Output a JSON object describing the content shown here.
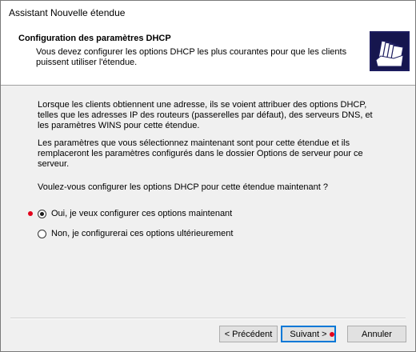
{
  "window": {
    "title": "Assistant Nouvelle étendue"
  },
  "header": {
    "title": "Configuration des paramètres DHCP",
    "subtitle": "Vous devez configurer les options DHCP les plus courantes pour que les clients puissent utiliser l'étendue.",
    "icon": "folder-documents-icon"
  },
  "body": {
    "paragraph1": "Lorsque les clients obtiennent une adresse, ils se voient attribuer des options DHCP, telles que les adresses IP des routeurs (passerelles par défaut), des serveurs DNS, et les paramètres WINS pour cette étendue.",
    "paragraph2": "Les paramètres que vous sélectionnez maintenant sont pour cette étendue et ils remplaceront les paramètres configurés dans le dossier Options de serveur pour ce serveur.",
    "question": "Voulez-vous configurer les options DHCP pour cette étendue maintenant ?"
  },
  "options": [
    {
      "label": "Oui, je veux configurer ces options maintenant",
      "selected": true
    },
    {
      "label": "Non, je configurerai ces options ultérieurement",
      "selected": false
    }
  ],
  "buttons": {
    "previous": "< Précédent",
    "next": "Suivant >",
    "cancel": "Annuler"
  },
  "colors": {
    "marker": "#e3001b",
    "header_bg": "#ffffff",
    "dialog_bg": "#f0f0f0",
    "focus_border": "#0078d7"
  }
}
